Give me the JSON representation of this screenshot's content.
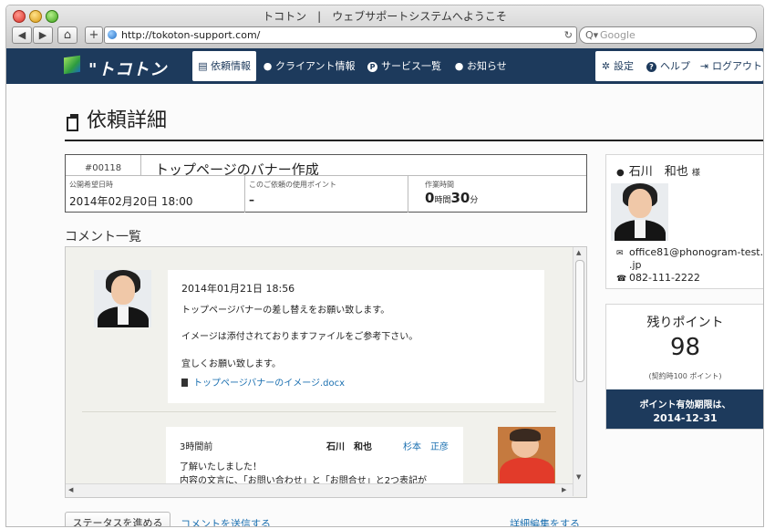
{
  "browser": {
    "window_title": "トコトン　|　ウェブサポートシステムへようこそ",
    "url": "http://tokoton-support.com/",
    "search_placeholder": "Google",
    "back_glyph": "◀",
    "forward_glyph": "▶",
    "home_glyph": "⌂",
    "add_glyph": "+",
    "reload_glyph": "↻",
    "search_glyph": "Q▾"
  },
  "nav": {
    "logo_text": "\"トコトン",
    "items": [
      {
        "label": "依頼情報",
        "icon": "document-icon",
        "active": true
      },
      {
        "label": "クライアント情報",
        "icon": "person-icon"
      },
      {
        "label": "サービス一覧",
        "icon": "p-circle-icon"
      },
      {
        "label": "お知らせ",
        "icon": "speech-bubble-icon"
      }
    ],
    "right": [
      {
        "label": "設定",
        "icon": "gear-icon"
      },
      {
        "label": "ヘルプ",
        "icon": "question-icon"
      },
      {
        "label": "ログアウト",
        "icon": "logout-icon"
      }
    ]
  },
  "page": {
    "title": "依頼詳細",
    "request": {
      "id": "#00118",
      "name": "トップページのバナー作成",
      "fields": [
        {
          "label": "公開希望日時",
          "value": "2014年02月20日 18:00"
        },
        {
          "label": "このご依頼の使用ポイント",
          "value": "–"
        },
        {
          "label": "作業時間",
          "hours": "0",
          "hours_unit": "時間",
          "minutes": "30",
          "minutes_unit": "分"
        }
      ]
    },
    "comments_heading": "コメント一覧",
    "comments": [
      {
        "timestamp": "2014年01月21日 18:56",
        "lines": [
          "トップページバナーの差し替えをお願い致します。",
          "イメージは添付されておりますファイルをご参考下さい。",
          "宜しくお願い致します。"
        ],
        "attachment": "トップページバナーのイメージ.docx"
      },
      {
        "timestamp": "3時間前",
        "author": "石川　和也",
        "recipient": "杉本　正彦",
        "lines": [
          "了解いたしました！",
          "内容の文言に、「お問い合わせ」と「お問合せ」と2つ表記が"
        ]
      }
    ],
    "buttons": {
      "advance_status": "ステータスを進める",
      "send_comment": "コメントを送信する",
      "edit_details": "詳細編集をする"
    }
  },
  "sidebar": {
    "user": {
      "name": "石川　和也",
      "honorific": "様",
      "email_line1": "office81@phonogram-test.co",
      "email_line2": ".jp",
      "phone": "082-111-2222"
    },
    "points": {
      "title": "残りポイント",
      "value": "98",
      "note": "(契約時100 ポイント)",
      "expiry_label": "ポイント有効期限は、",
      "expiry_date": "2014-12-31"
    }
  },
  "colors": {
    "nav_bg": "#1d3a5c",
    "link": "#1a6fb0",
    "accent_dark": "#1d3a5c"
  }
}
